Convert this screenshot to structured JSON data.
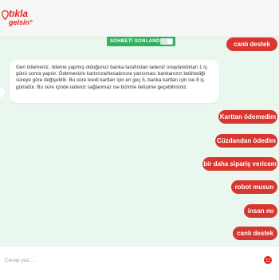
{
  "header": {
    "logo_line1": "tıkla",
    "logo_line2": "gelsin°"
  },
  "chat_controls": {
    "end_chat_label": "SOHBETİ SONLANDIR"
  },
  "messages": [
    {
      "from": "user",
      "text": "canlı destek"
    },
    {
      "from": "bot",
      "text": "Geri ödemeniz, ödeme yapmış olduğunuz banka tarafından iadeniz onaylandıktan 1 iş günü sonra yapılır. Ödemenizin kartınıza/hesabınıza yansıması bankanızın belirlediği süreye göre değişebilir. Bu süre kredi kartları için en geç 5, banka kartları için ise 8 iş günüdür. Bu süre içinde iadeniz sağlanmaz ise bizimle iletişime geçebilirsiniz."
    },
    {
      "from": "user",
      "text": "Karttan ödemedim"
    },
    {
      "from": "user",
      "text": "Cüzdandan ödedim"
    },
    {
      "from": "user",
      "text": "bir daha sipariş vericem"
    },
    {
      "from": "user",
      "text": "robot musun"
    },
    {
      "from": "user",
      "text": "insan mı"
    },
    {
      "from": "user",
      "text": "canlı destek"
    }
  ],
  "composer": {
    "placeholder": "Cevap yaz....",
    "emoji_icon": "emoji-icon"
  },
  "colors": {
    "brand_red": "#e2231a",
    "user_bubble": "#d9362f",
    "chat_background": "#e9f7ef",
    "end_chat_green": "#2eb35c"
  }
}
